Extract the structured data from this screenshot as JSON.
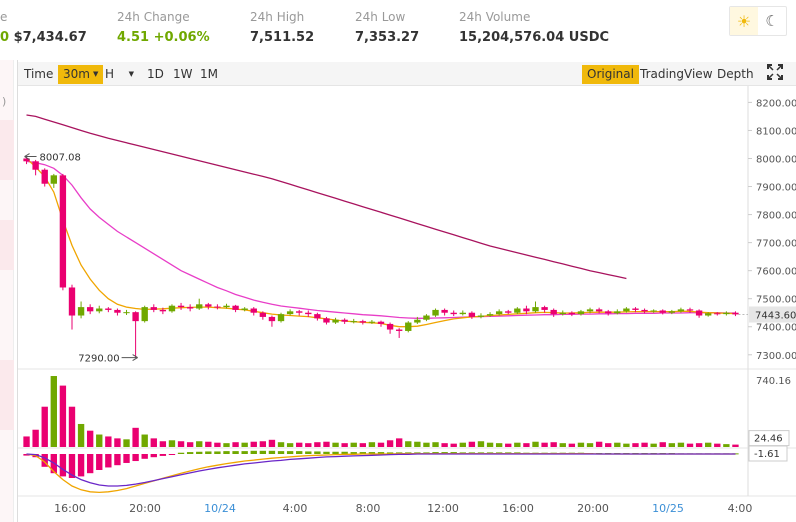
{
  "header": {
    "first_label": "e",
    "first_value_prefix": "0",
    "first_value": "$7,434.67",
    "stats": [
      {
        "label": "24h Change",
        "value": "4.51  +0.06%"
      },
      {
        "label": "24h High",
        "value": "7,511.52"
      },
      {
        "label": "24h Low",
        "value": "7,353.27"
      },
      {
        "label": "24h Volume",
        "value": "15,204,576.04 USDC"
      }
    ]
  },
  "theme": {
    "light_icon": "sun-icon",
    "dark_icon": "moon-icon"
  },
  "toolbar": {
    "time": "Time",
    "interval": "30m",
    "interval_h": "H",
    "d1": "1D",
    "w1": "1W",
    "m1": "1M",
    "original": "Original",
    "tradingview": "TradingView",
    "depth": "Depth",
    "fullscreen_icon": "fullscreen-icon"
  },
  "left_axis_fragment": ")",
  "annotations": {
    "high": "8007.08",
    "low": "7290.00"
  },
  "chart_data": {
    "type": "candlestick",
    "y_price_ticks": [
      "8200.00",
      "8100.00",
      "8000.00",
      "7900.00",
      "7800.00",
      "7700.00",
      "7600.00",
      "7500.00",
      "7400.00",
      "7300.00"
    ],
    "ylim": [
      7260,
      8230
    ],
    "current_price": "7443.60",
    "volume_max_label": "740.16",
    "volume_current": "24.46",
    "macd_current": "-1.61",
    "x_ticks": [
      "16:00",
      "20:00",
      "10/24",
      "4:00",
      "8:00",
      "12:00",
      "16:00",
      "20:00",
      "10/25",
      "4:00"
    ],
    "x_tick_colors": [
      "#555",
      "#555",
      "#3b8fd6",
      "#555",
      "#555",
      "#555",
      "#555",
      "#555",
      "#3b8fd6",
      "#555"
    ],
    "candles": [
      [
        8000,
        7990,
        7980,
        8007
      ],
      [
        7990,
        7960,
        7940,
        7995
      ],
      [
        7960,
        7910,
        7900,
        7965
      ],
      [
        7910,
        7940,
        7895,
        7945
      ],
      [
        7940,
        7540,
        7530,
        7945
      ],
      [
        7540,
        7440,
        7390,
        7550
      ],
      [
        7440,
        7470,
        7430,
        7490
      ],
      [
        7470,
        7455,
        7445,
        7480
      ],
      [
        7455,
        7465,
        7448,
        7475
      ],
      [
        7465,
        7460,
        7452,
        7470
      ],
      [
        7460,
        7450,
        7440,
        7465
      ],
      [
        7450,
        7452,
        7442,
        7460
      ],
      [
        7452,
        7420,
        7290,
        7455
      ],
      [
        7420,
        7470,
        7415,
        7475
      ],
      [
        7470,
        7460,
        7452,
        7480
      ],
      [
        7460,
        7455,
        7445,
        7468
      ],
      [
        7455,
        7475,
        7450,
        7480
      ],
      [
        7475,
        7470,
        7460,
        7485
      ],
      [
        7470,
        7465,
        7455,
        7480
      ],
      [
        7465,
        7480,
        7460,
        7500
      ],
      [
        7480,
        7472,
        7462,
        7485
      ],
      [
        7472,
        7470,
        7462,
        7480
      ],
      [
        7470,
        7475,
        7465,
        7482
      ],
      [
        7475,
        7460,
        7452,
        7478
      ],
      [
        7460,
        7465,
        7455,
        7470
      ],
      [
        7465,
        7450,
        7440,
        7470
      ],
      [
        7450,
        7435,
        7425,
        7455
      ],
      [
        7435,
        7420,
        7400,
        7440
      ],
      [
        7420,
        7445,
        7415,
        7450
      ],
      [
        7445,
        7455,
        7440,
        7462
      ],
      [
        7455,
        7450,
        7440,
        7460
      ],
      [
        7450,
        7445,
        7435,
        7458
      ],
      [
        7445,
        7430,
        7422,
        7450
      ],
      [
        7430,
        7415,
        7408,
        7435
      ],
      [
        7415,
        7425,
        7410,
        7432
      ],
      [
        7425,
        7418,
        7410,
        7430
      ],
      [
        7418,
        7420,
        7412,
        7428
      ],
      [
        7420,
        7415,
        7408,
        7425
      ],
      [
        7415,
        7418,
        7410,
        7424
      ],
      [
        7418,
        7410,
        7400,
        7422
      ],
      [
        7410,
        7390,
        7375,
        7415
      ],
      [
        7390,
        7385,
        7360,
        7395
      ],
      [
        7385,
        7415,
        7380,
        7420
      ],
      [
        7415,
        7425,
        7410,
        7435
      ],
      [
        7425,
        7440,
        7420,
        7445
      ],
      [
        7440,
        7460,
        7435,
        7465
      ],
      [
        7460,
        7450,
        7440,
        7465
      ],
      [
        7450,
        7445,
        7438,
        7458
      ],
      [
        7445,
        7450,
        7440,
        7458
      ],
      [
        7450,
        7435,
        7428,
        7455
      ],
      [
        7435,
        7440,
        7430,
        7448
      ],
      [
        7440,
        7445,
        7435,
        7452
      ],
      [
        7445,
        7455,
        7440,
        7462
      ],
      [
        7455,
        7450,
        7445,
        7460
      ],
      [
        7450,
        7465,
        7445,
        7470
      ],
      [
        7465,
        7455,
        7445,
        7475
      ],
      [
        7455,
        7470,
        7450,
        7490
      ],
      [
        7470,
        7460,
        7450,
        7475
      ],
      [
        7460,
        7445,
        7435,
        7465
      ],
      [
        7445,
        7450,
        7440,
        7458
      ],
      [
        7450,
        7445,
        7438,
        7455
      ],
      [
        7445,
        7455,
        7440,
        7460
      ],
      [
        7455,
        7462,
        7448,
        7468
      ],
      [
        7462,
        7455,
        7448,
        7468
      ],
      [
        7455,
        7448,
        7440,
        7460
      ],
      [
        7448,
        7455,
        7444,
        7462
      ],
      [
        7455,
        7465,
        7450,
        7470
      ],
      [
        7465,
        7460,
        7452,
        7470
      ],
      [
        7460,
        7455,
        7448,
        7465
      ],
      [
        7455,
        7458,
        7450,
        7462
      ],
      [
        7458,
        7450,
        7444,
        7462
      ],
      [
        7450,
        7455,
        7445,
        7460
      ],
      [
        7455,
        7462,
        7450,
        7468
      ],
      [
        7462,
        7458,
        7450,
        7468
      ],
      [
        7458,
        7440,
        7432,
        7462
      ],
      [
        7440,
        7448,
        7436,
        7452
      ],
      [
        7448,
        7445,
        7440,
        7452
      ],
      [
        7445,
        7450,
        7440,
        7455
      ],
      [
        7450,
        7444,
        7438,
        7455
      ]
    ],
    "volumes": [
      110,
      180,
      420,
      740,
      640,
      420,
      240,
      170,
      130,
      110,
      90,
      80,
      200,
      130,
      90,
      60,
      70,
      60,
      50,
      60,
      55,
      45,
      40,
      50,
      45,
      55,
      60,
      75,
      50,
      40,
      45,
      40,
      50,
      55,
      45,
      40,
      45,
      40,
      50,
      45,
      70,
      90,
      60,
      55,
      45,
      50,
      40,
      35,
      45,
      55,
      60,
      45,
      40,
      35,
      45,
      40,
      55,
      45,
      50,
      40,
      35,
      45,
      40,
      55,
      40,
      45,
      35,
      40,
      45,
      35,
      50,
      40,
      45,
      35,
      40,
      45,
      35,
      30,
      25
    ],
    "ma_fast": [
      8000,
      7970,
      7935,
      7880,
      7780,
      7690,
      7620,
      7570,
      7530,
      7500,
      7480,
      7470,
      7465,
      7462,
      7463,
      7464,
      7466,
      7468,
      7469,
      7470,
      7470,
      7468,
      7466,
      7463,
      7460,
      7455,
      7450,
      7445,
      7442,
      7440,
      7438,
      7436,
      7432,
      7428,
      7424,
      7420,
      7418,
      7416,
      7414,
      7412,
      7405,
      7400,
      7400,
      7402,
      7408,
      7415,
      7422,
      7428,
      7432,
      7435,
      7437,
      7440,
      7442,
      7444,
      7446,
      7448,
      7450,
      7451,
      7450,
      7449,
      7449,
      7450,
      7451,
      7452,
      7452,
      7452,
      7453,
      7454,
      7454,
      7454,
      7454,
      7454,
      7455,
      7455,
      7452,
      7450,
      7449,
      7448,
      7447
    ],
    "ma_mid": [
      7990,
      7985,
      7978,
      7965,
      7940,
      7905,
      7860,
      7820,
      7790,
      7765,
      7740,
      7720,
      7700,
      7680,
      7660,
      7640,
      7620,
      7600,
      7585,
      7570,
      7555,
      7540,
      7528,
      7515,
      7505,
      7495,
      7487,
      7480,
      7474,
      7470,
      7466,
      7462,
      7458,
      7455,
      7452,
      7449,
      7446,
      7443,
      7441,
      7439,
      7436,
      7433,
      7431,
      7430,
      7430,
      7431,
      7432,
      7433,
      7434,
      7435,
      7436,
      7437,
      7438,
      7439,
      7440,
      7441,
      7442,
      7443,
      7443,
      7444,
      7444,
      7445,
      7445,
      7446,
      7446,
      7447,
      7447,
      7448,
      7448,
      7448,
      7449,
      7449,
      7449,
      7450,
      7450,
      7450,
      7450,
      7449,
      7449
    ],
    "ma_slow": [
      8155,
      8150,
      8140,
      8130,
      8120,
      8110,
      8100,
      8090,
      8081,
      8072,
      8064,
      8056,
      8048,
      8040,
      8032,
      8024,
      8016,
      8008,
      8000,
      7992,
      7984,
      7976,
      7968,
      7960,
      7952,
      7944,
      7936,
      7928,
      7918,
      7908,
      7898,
      7888,
      7878,
      7868,
      7858,
      7848,
      7838,
      7828,
      7818,
      7808,
      7798,
      7788,
      7778,
      7768,
      7758,
      7748,
      7738,
      7728,
      7718,
      7708,
      7698,
      7688,
      7680,
      7672,
      7664,
      7656,
      7648,
      7640,
      7632,
      7624,
      7616,
      7608,
      7600,
      7593,
      7586,
      7579,
      7572
    ],
    "macd_hist": [
      -5,
      -10,
      -40,
      -60,
      -70,
      -75,
      -70,
      -60,
      -50,
      -42,
      -35,
      -28,
      -22,
      -15,
      -10,
      -6,
      -3,
      4,
      6,
      7,
      8,
      8,
      9,
      9,
      9,
      10,
      10,
      10,
      9,
      9,
      9,
      8,
      8,
      7,
      7,
      7,
      6,
      6,
      6,
      6,
      5,
      5,
      5,
      5,
      5,
      6,
      6,
      6,
      5,
      5,
      5,
      5,
      5,
      5,
      5,
      4,
      4,
      4,
      4,
      4,
      4,
      4,
      3,
      3,
      3,
      3,
      3,
      3,
      3,
      3,
      3,
      3,
      2,
      2,
      2,
      2,
      2,
      2,
      2
    ],
    "macd_dif": [
      0,
      -5,
      -25,
      -55,
      -80,
      -100,
      -112,
      -118,
      -120,
      -118,
      -114,
      -108,
      -100,
      -92,
      -84,
      -76,
      -68,
      -60,
      -53,
      -46,
      -40,
      -35,
      -30,
      -26,
      -22,
      -19,
      -16,
      -13,
      -11,
      -9,
      -7,
      -5,
      -4,
      -3,
      -2,
      -1,
      -1,
      0,
      0,
      0,
      0,
      1,
      1,
      1,
      1,
      1,
      1,
      1,
      1,
      1,
      1,
      1,
      1,
      1,
      1,
      1,
      1,
      1,
      1,
      1,
      1,
      1,
      1,
      0,
      0,
      0,
      0,
      0,
      0,
      0,
      0,
      0,
      0,
      0,
      0,
      0,
      0,
      0,
      0
    ],
    "macd_dea": [
      0,
      -2,
      -12,
      -28,
      -48,
      -66,
      -80,
      -90,
      -97,
      -100,
      -100,
      -98,
      -94,
      -89,
      -83,
      -77,
      -71,
      -65,
      -59,
      -53,
      -48,
      -43,
      -39,
      -35,
      -31,
      -28,
      -25,
      -22,
      -20,
      -17,
      -15,
      -13,
      -11,
      -9,
      -8,
      -7,
      -6,
      -5,
      -4,
      -3,
      -2,
      -1,
      -1,
      0,
      0,
      0,
      0,
      0,
      0,
      0,
      0,
      0,
      0,
      0,
      0,
      0,
      0,
      0,
      0,
      0,
      0,
      0,
      0,
      0,
      0,
      0,
      0,
      0,
      0,
      0,
      0,
      0,
      0,
      0,
      0,
      0,
      0,
      0,
      0
    ]
  },
  "colors": {
    "up": "#70a800",
    "down": "#ea0070",
    "ma_fast": "#f0a500",
    "ma_mid": "#e83ec8",
    "ma_slow": "#a8135e",
    "macd_dea": "#6a26c8",
    "accent": "#f0b90b",
    "current_price_bg": "#e6e6e6"
  }
}
